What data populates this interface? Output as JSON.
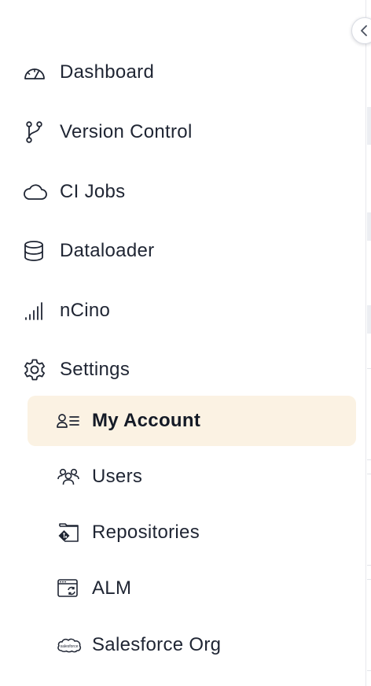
{
  "sidebar": {
    "collapse_icon": "chevron-left-icon",
    "items": [
      {
        "label": "Dashboard",
        "icon": "gauge-icon"
      },
      {
        "label": "Version Control",
        "icon": "git-branch-icon"
      },
      {
        "label": "CI Jobs",
        "icon": "cloud-icon"
      },
      {
        "label": "Dataloader",
        "icon": "database-icon"
      },
      {
        "label": "nCino",
        "icon": "signal-bars-icon"
      },
      {
        "label": "Settings",
        "icon": "gear-icon"
      }
    ],
    "settings_sub_items": [
      {
        "label": "My Account",
        "icon": "user-list-icon",
        "active": true
      },
      {
        "label": "Users",
        "icon": "users-icon",
        "active": false
      },
      {
        "label": "Repositories",
        "icon": "repository-icon",
        "active": false
      },
      {
        "label": "ALM",
        "icon": "browser-sync-icon",
        "active": false
      },
      {
        "label": "Salesforce Org",
        "icon": "salesforce-cloud-icon",
        "active": false
      }
    ],
    "salesforce_logo_text": "salesforce"
  },
  "colors": {
    "text": "#1f2533",
    "active_background": "#fbf2e3",
    "border": "#d9dce3"
  }
}
